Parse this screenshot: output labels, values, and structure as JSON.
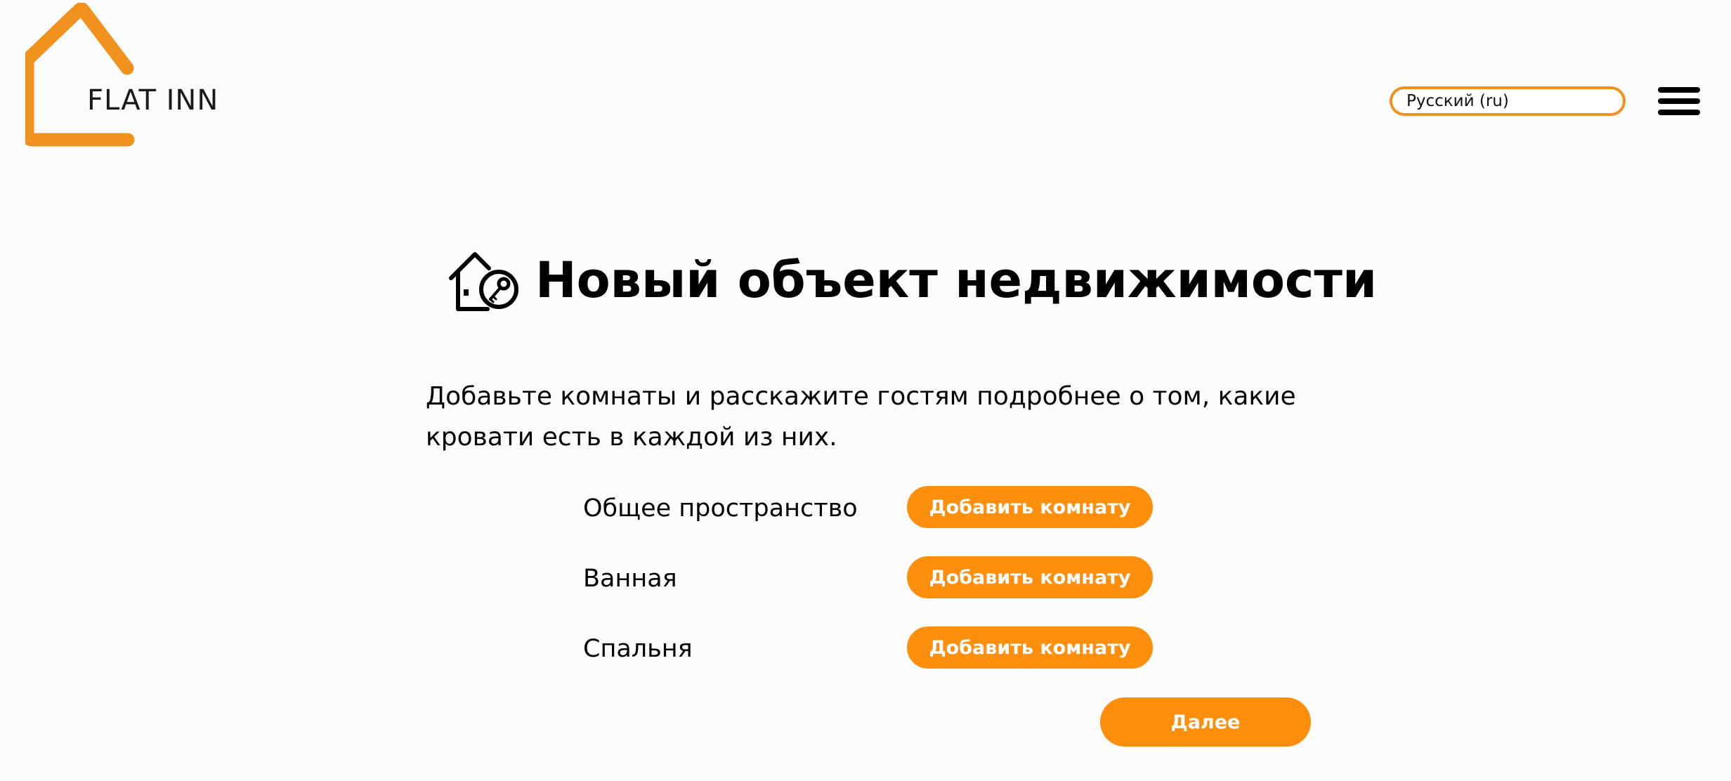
{
  "header": {
    "logo_text": "FLAT INN",
    "logo_icon": "house-outline-icon",
    "language_selected": "Русский (ru)",
    "menu_icon": "hamburger-menu-icon",
    "accent_color": "#f2921e"
  },
  "main": {
    "title_icon": "house-search-icon",
    "title": "Новый объект недвижимости",
    "description": "Добавьте комнаты и расскажите гостям подробнее о том, какие кровати есть в каждой из них.",
    "rooms": [
      {
        "label": "Общее пространство",
        "button_label": "Добавить комнату"
      },
      {
        "label": "Ванная",
        "button_label": "Добавить комнату"
      },
      {
        "label": "Спальня",
        "button_label": "Добавить комнату"
      }
    ],
    "next_label": "Далее",
    "button_color": "#fe8f0d"
  }
}
